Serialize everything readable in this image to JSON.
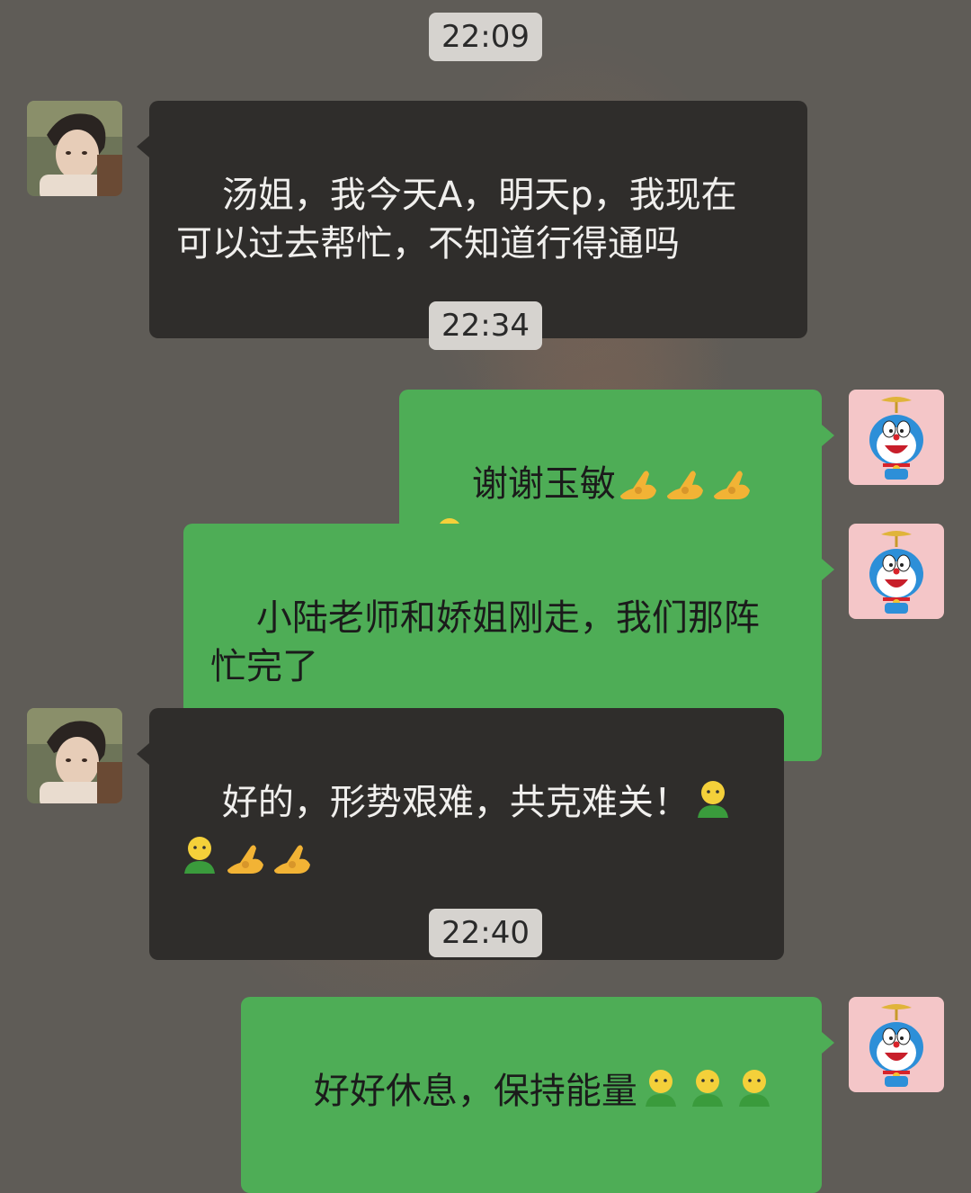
{
  "messages": [
    {
      "type": "time",
      "text": "22:09"
    },
    {
      "type": "msg",
      "side": "left",
      "text": "汤姐，我今天A，明天p，我现在\n可以过去帮忙，不知道行得通吗"
    },
    {
      "type": "time",
      "text": "22:34"
    },
    {
      "type": "msg",
      "side": "right",
      "text": "谢谢玉敏",
      "emojis": [
        "ok-hand-emoji",
        "ok-hand-emoji",
        "ok-hand-emoji",
        "green-person-emoji"
      ]
    },
    {
      "type": "msg",
      "side": "right",
      "text": "小陆老师和娇姐刚走，我们那阵\n忙完了"
    },
    {
      "type": "msg",
      "side": "left",
      "text": "好的，形势艰难，共克难关！",
      "emojis": [
        "green-person-emoji",
        "green-person-emoji",
        "ok-hand-emoji",
        "ok-hand-emoji"
      ]
    },
    {
      "type": "time",
      "text": "22:40"
    },
    {
      "type": "msg",
      "side": "right",
      "text": "好好休息，保持能量",
      "emojis": [
        "green-person-emoji",
        "green-person-emoji",
        "green-person-emoji"
      ]
    }
  ],
  "avatars": {
    "left": "person-photo-avatar",
    "right": "doraemon-avatar"
  },
  "colors": {
    "background": "#5f5c57",
    "incoming_bubble": "#2f2d2b",
    "outgoing_bubble": "#4ead56",
    "timestamp_bg": "#d6d3cf"
  }
}
